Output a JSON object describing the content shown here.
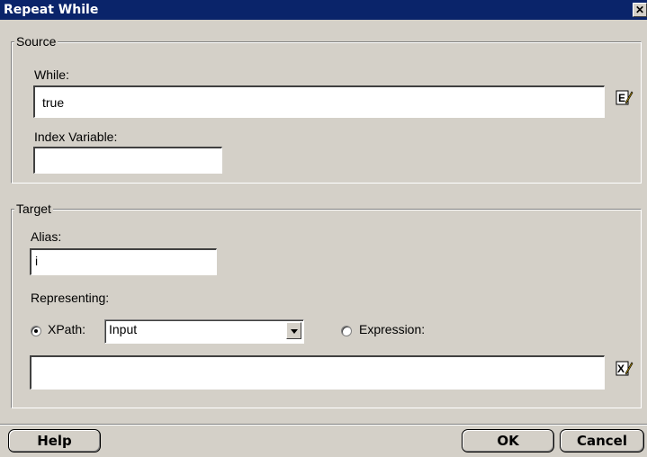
{
  "window": {
    "title": "Repeat While",
    "close_label": "✕"
  },
  "source": {
    "legend": "Source",
    "while_label": "While:",
    "while_value": "true",
    "index_label": "Index Variable:",
    "index_value": ""
  },
  "target": {
    "legend": "Target",
    "alias_label": "Alias:",
    "alias_value": "i",
    "representing_label": "Representing:",
    "xpath_label": "XPath:",
    "xpath_selected": "Input",
    "expression_label": "Expression:",
    "expression_value": ""
  },
  "footer": {
    "help": "Help",
    "ok": "OK",
    "cancel": "Cancel"
  },
  "colors": {
    "titlebar": "#0a246a",
    "face": "#d4d0c8"
  },
  "icons": [
    "edit-expression-icon",
    "xpath-builder-icon",
    "close-icon",
    "dropdown-arrow-icon"
  ]
}
